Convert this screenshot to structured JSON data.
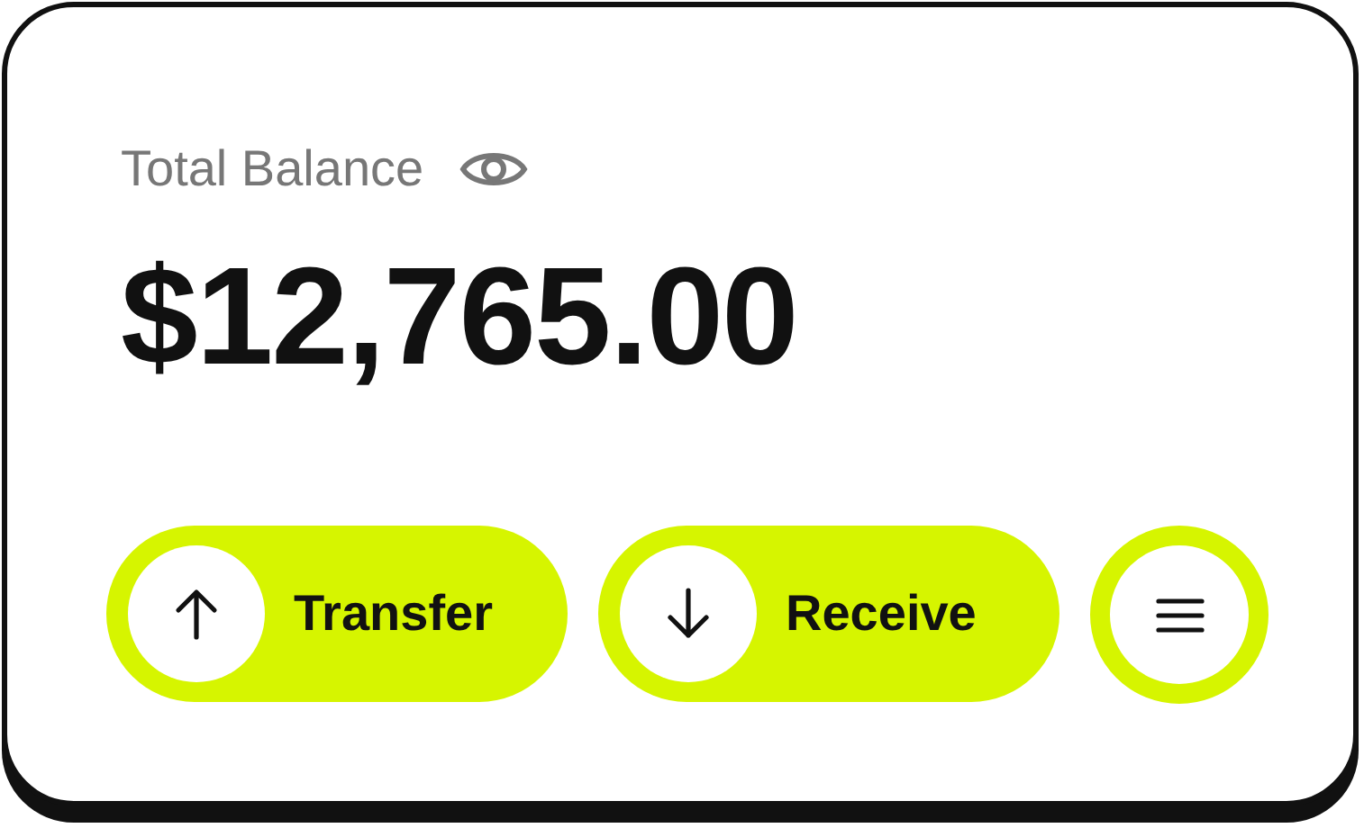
{
  "balance": {
    "label": "Total Balance",
    "amount": "$12,765.00"
  },
  "actions": [
    {
      "kind": "send",
      "label": "Transfer"
    },
    {
      "kind": "receive",
      "label": "Receive"
    },
    {
      "kind": "menu"
    }
  ]
}
